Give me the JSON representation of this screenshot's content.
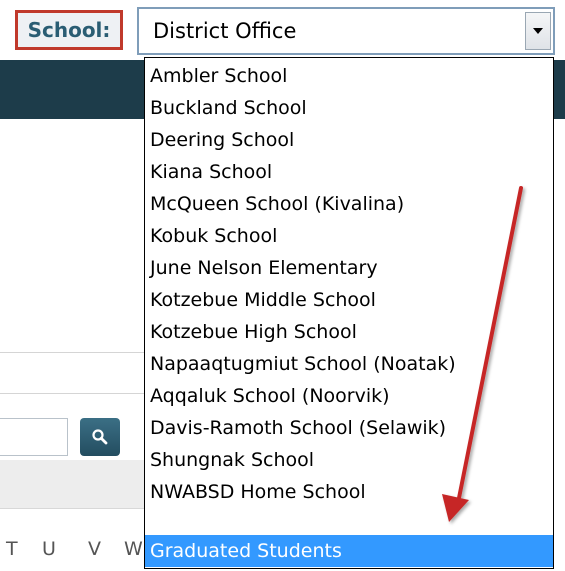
{
  "school_selector": {
    "label": "School:",
    "selected_value": "District Office",
    "options": [
      "Ambler School",
      "Buckland School",
      "Deering School",
      "Kiana School",
      "McQueen School (Kivalina)",
      "Kobuk School",
      "June Nelson Elementary",
      "Kotzebue Middle School",
      "Kotzebue High School",
      "Napaaqtugmiut School (Noatak)",
      "Aqqaluk School (Noorvik)",
      "Davis-Ramoth School (Selawik)",
      "Shungnak School",
      "NWABSD Home School",
      "Graduated Students"
    ],
    "highlighted_option": "Graduated Students"
  },
  "background_page": {
    "alphabet_letters": [
      "T",
      "U",
      "V",
      "W"
    ],
    "search_icon": "search-icon"
  },
  "annotation": {
    "arrow_color": "#c62828",
    "label_border_color": "#c0392b"
  },
  "colors": {
    "label_text": "#2a5d73",
    "header_band": "#1d3c4a",
    "selection_highlight": "#3399ff"
  }
}
